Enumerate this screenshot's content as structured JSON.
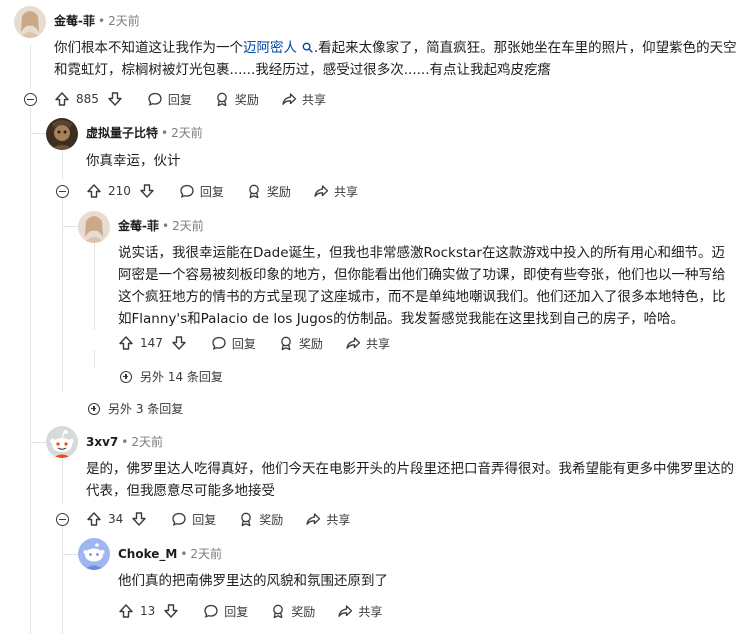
{
  "comments": [
    {
      "author": "金莓-菲",
      "time": "2天前",
      "text_pre": "你们根本不知道这让我作为一个",
      "link_text": "迈阿密人",
      "text_post": ".看起来太像家了，简直疯狂。那张她坐在车里的照片，仰望紫色的天空和霓虹灯，棕榈树被灯光包裹......我经历过，感受过很多次......有点让我起鸡皮疙瘩",
      "votes": "885",
      "reply": "回复",
      "award": "奖励",
      "share": "共享"
    },
    {
      "author": "虚拟量子比特",
      "time": "2天前",
      "text": "你真幸运，伙计",
      "votes": "210",
      "reply": "回复",
      "award": "奖励",
      "share": "共享"
    },
    {
      "author": "金莓-菲",
      "time": "2天前",
      "text": "说实话，我很幸运能在Dade诞生，但我也非常感激Rockstar在这款游戏中投入的所有用心和细节。迈阿密是一个容易被刻板印象的地方，但你能看出他们确实做了功课，即使有些夸张，他们也以一种写给这个疯狂地方的情书的方式呈现了这座城市，而不是单纯地嘲讽我们。他们还加入了很多本地特色，比如Flanny's和Palacio de los Jugos的仿制品。我发誓感觉我能在这里找到自己的房子，哈哈。",
      "votes": "147",
      "reply": "回复",
      "award": "奖励",
      "share": "共享"
    },
    {
      "author": "3xv7",
      "time": "2天前",
      "text": "是的，佛罗里达人吃得真好，他们今天在电影开头的片段里还把口音弄得很对。我希望能有更多中佛罗里达的代表，但我愿意尽可能多地接受",
      "votes": "34",
      "reply": "回复",
      "award": "奖励",
      "share": "共享"
    },
    {
      "author": "Choke_M",
      "time": "2天前",
      "text": "他们真的把南佛罗里达的风貌和氛围还原到了",
      "votes": "13",
      "reply": "回复",
      "award": "奖励",
      "share": "共享"
    }
  ],
  "more_replies_1": "另外 14 条回复",
  "more_replies_2": "另外 3 条回复",
  "meta_separator": "•"
}
